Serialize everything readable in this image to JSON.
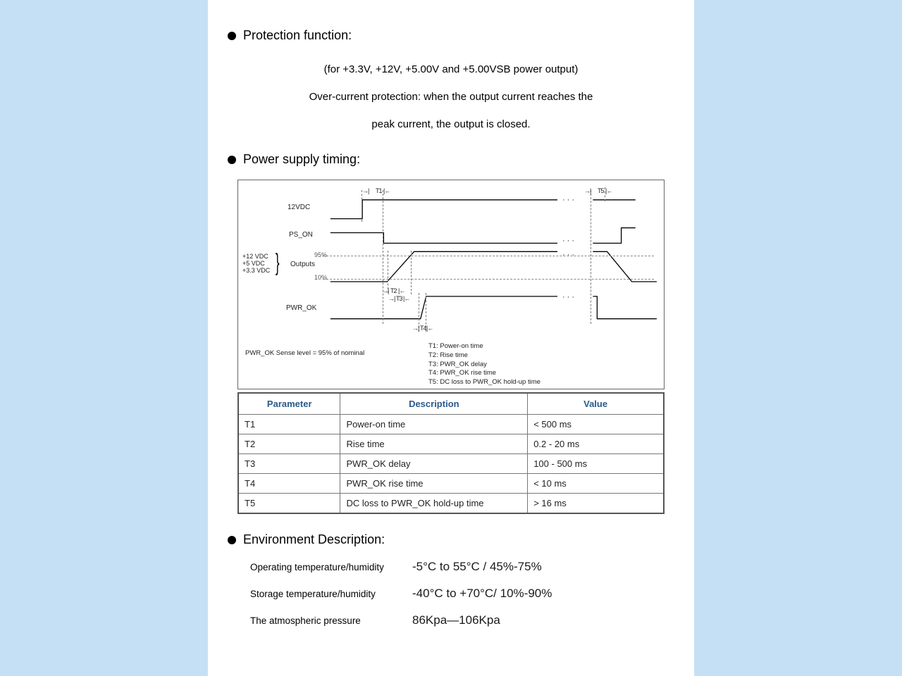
{
  "sections": {
    "protection": {
      "title": "Protection function:",
      "line1": "(for +3.3V, +12V, +5.00V and +5.00VSB power output)",
      "line2": "Over-current protection: when the output current reaches the",
      "line3": "peak current, the output is closed."
    },
    "timing": {
      "title": "Power supply timing:",
      "diagram": {
        "signal1": "12VDC",
        "signal2": "PS_ON",
        "signal3_outputs": "Outputs",
        "signal3_left1": "+12 VDC",
        "signal3_left2": "+5 VDC",
        "signal3_left3": "+3.3 VDC",
        "pct95": "95%",
        "pct10": "10%",
        "signal4": "PWR_OK",
        "t1": "T1",
        "t2": "T2",
        "t3": "T3",
        "t4": "T4",
        "t5": "T5",
        "note_left": "PWR_OK Sense level = 95% of nominal",
        "note1": "T1: Power-on time",
        "note2": "T2: Rise time",
        "note3": "T3: PWR_OK delay",
        "note4": "T4: PWR_OK rise time",
        "note5": "T5: DC loss to PWR_OK hold-up time"
      },
      "table": {
        "headers": {
          "param": "Parameter",
          "desc": "Description",
          "value": "Value"
        },
        "rows": [
          {
            "param": "T1",
            "desc": "Power-on time",
            "value": "< 500 ms"
          },
          {
            "param": "T2",
            "desc": "Rise time",
            "value": "0.2 - 20 ms"
          },
          {
            "param": "T3",
            "desc": "PWR_OK delay",
            "value": "100 - 500 ms"
          },
          {
            "param": "T4",
            "desc": "PWR_OK rise time",
            "value": "< 10 ms"
          },
          {
            "param": "T5",
            "desc": "DC loss to PWR_OK hold-up time",
            "value": "> 16 ms"
          }
        ]
      }
    },
    "environment": {
      "title": "Environment Description:",
      "rows": [
        {
          "label": "Operating temperature/humidity",
          "value": "-5°C to 55°C / 45%-75%"
        },
        {
          "label": "Storage temperature/humidity",
          "value": "-40°C to +70°C/ 10%-90%"
        },
        {
          "label": "The atmospheric pressure",
          "value": "86Kpa—106Kpa"
        }
      ]
    }
  }
}
